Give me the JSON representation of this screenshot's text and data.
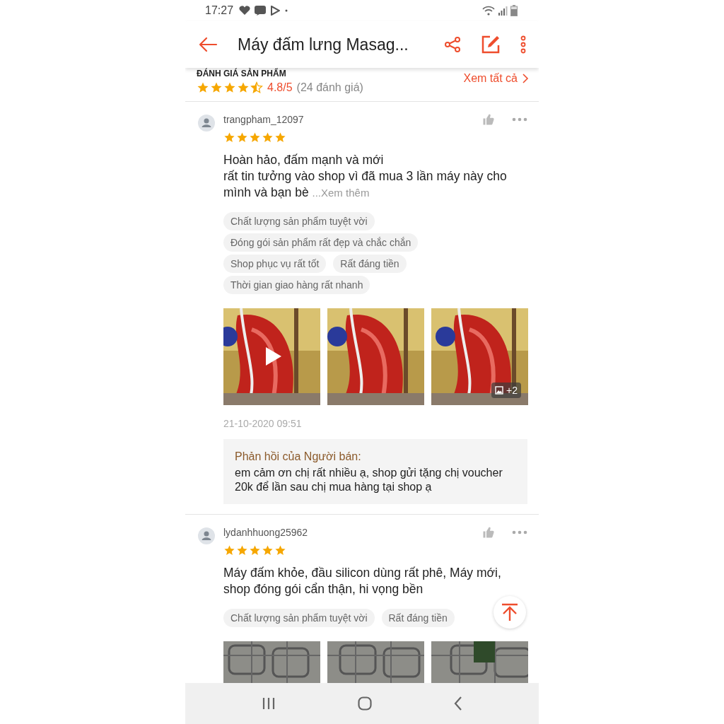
{
  "status_bar": {
    "time": "17:27"
  },
  "header": {
    "title": "Máy đấm lưng Masag..."
  },
  "rating_summary": {
    "heading": "ĐÁNH GIÁ SẢN PHẨM",
    "stars": 4.5,
    "score": "4.8/5",
    "count": "(24 đánh giá)",
    "see_all": "Xem tất cả"
  },
  "reviews": [
    {
      "username": "trangpham_12097",
      "stars": 5,
      "text": "Hoàn hảo, đấm mạnh và mới\nrất tin tưởng vào shop vì đã mua 3 lần máy này cho mình và bạn bè",
      "more": "...Xem thêm",
      "tags": [
        "Chất lượng sản phẩm tuyệt vời",
        "Đóng gói sản phẩm rất đẹp và chắc chắn",
        "Shop phục vụ rất tốt",
        "Rất đáng tiền",
        "Thời gian giao hàng rất nhanh"
      ],
      "media": [
        {
          "kind": "video"
        },
        {
          "kind": "picture"
        },
        {
          "kind": "picture",
          "extra": "+2"
        }
      ],
      "date": "21-10-2020 09:51",
      "reply": {
        "label": "Phản hồi của Người bán:",
        "text": "em cảm ơn chị rất nhiều ạ, shop gửi tặng chị voucher 20k để lần sau chị mua hàng tại shop ạ"
      }
    },
    {
      "username": "lydanhhuong25962",
      "stars": 5,
      "text": "Máy đấm khỏe, đầu silicon dùng rất phê, Máy mới, shop đóng gói cẩn thận, hi vọng bền",
      "tags": [
        "Chất lượng sản phẩm tuyệt vời",
        "Rất đáng tiền"
      ],
      "media": [
        {
          "kind": "picture"
        },
        {
          "kind": "picture"
        },
        {
          "kind": "picture"
        }
      ]
    }
  ]
}
